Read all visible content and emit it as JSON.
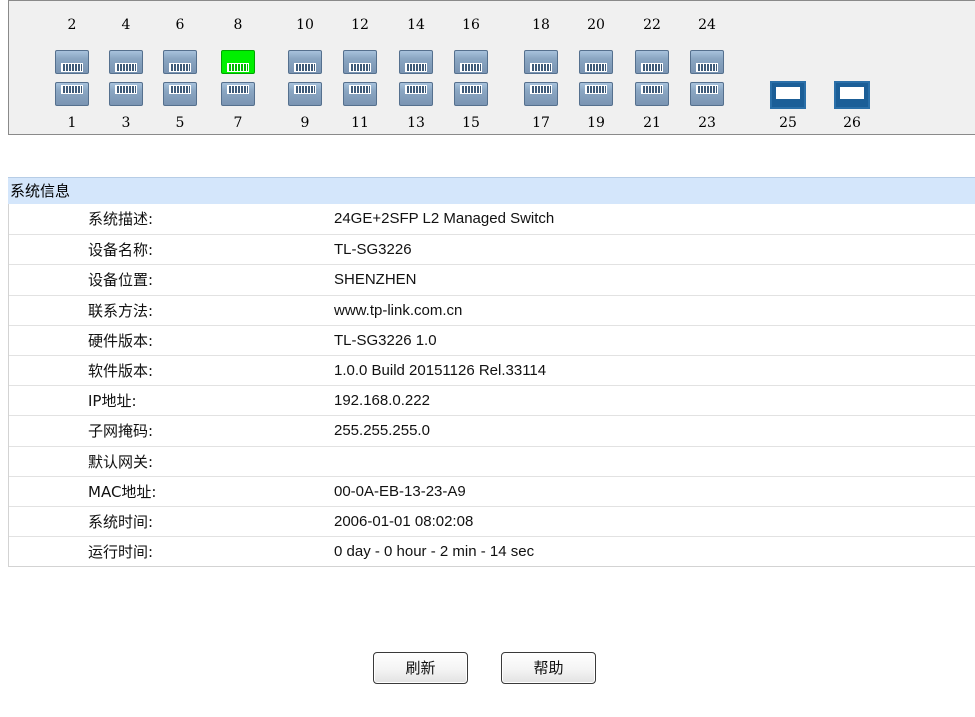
{
  "switch_panel": {
    "top_ports": [
      {
        "number": "2",
        "status": "down"
      },
      {
        "number": "4",
        "status": "down"
      },
      {
        "number": "6",
        "status": "down"
      },
      {
        "number": "8",
        "status": "up"
      },
      {
        "number": "10",
        "status": "down"
      },
      {
        "number": "12",
        "status": "down"
      },
      {
        "number": "14",
        "status": "down"
      },
      {
        "number": "16",
        "status": "down"
      },
      {
        "number": "18",
        "status": "down"
      },
      {
        "number": "20",
        "status": "down"
      },
      {
        "number": "22",
        "status": "down"
      },
      {
        "number": "24",
        "status": "down"
      }
    ],
    "bottom_ports": [
      {
        "number": "1",
        "status": "down"
      },
      {
        "number": "3",
        "status": "down"
      },
      {
        "number": "5",
        "status": "down"
      },
      {
        "number": "7",
        "status": "down"
      },
      {
        "number": "9",
        "status": "down"
      },
      {
        "number": "11",
        "status": "down"
      },
      {
        "number": "13",
        "status": "down"
      },
      {
        "number": "15",
        "status": "down"
      },
      {
        "number": "17",
        "status": "down"
      },
      {
        "number": "19",
        "status": "down"
      },
      {
        "number": "21",
        "status": "down"
      },
      {
        "number": "23",
        "status": "down"
      }
    ],
    "sfp_ports": [
      {
        "number": "25",
        "status": "down"
      },
      {
        "number": "26",
        "status": "down"
      }
    ],
    "colors": {
      "link_up": "#00f000",
      "link_down": "#8aa6c2",
      "sfp": "#1b5e97"
    }
  },
  "system_info": {
    "title": "系统信息",
    "rows": [
      {
        "label": "系统描述:",
        "value": "24GE+2SFP L2 Managed Switch"
      },
      {
        "label": "设备名称:",
        "value": "TL-SG3226"
      },
      {
        "label": "设备位置:",
        "value": "SHENZHEN"
      },
      {
        "label": "联系方法:",
        "value": "www.tp-link.com.cn"
      },
      {
        "label": "硬件版本:",
        "value": "TL-SG3226 1.0"
      },
      {
        "label": "软件版本:",
        "value": "1.0.0 Build 20151126 Rel.33114"
      },
      {
        "label": "IP地址:",
        "value": "192.168.0.222"
      },
      {
        "label": "子网掩码:",
        "value": "255.255.255.0"
      },
      {
        "label": "默认网关:",
        "value": ""
      },
      {
        "label": "MAC地址:",
        "value": "00-0A-EB-13-23-A9"
      },
      {
        "label": "系统时间:",
        "value": "2006-01-01 08:02:08"
      },
      {
        "label": "运行时间:",
        "value": "0 day - 0 hour - 2 min - 14 sec"
      }
    ]
  },
  "buttons": {
    "refresh": "刷新",
    "help": "帮助"
  }
}
